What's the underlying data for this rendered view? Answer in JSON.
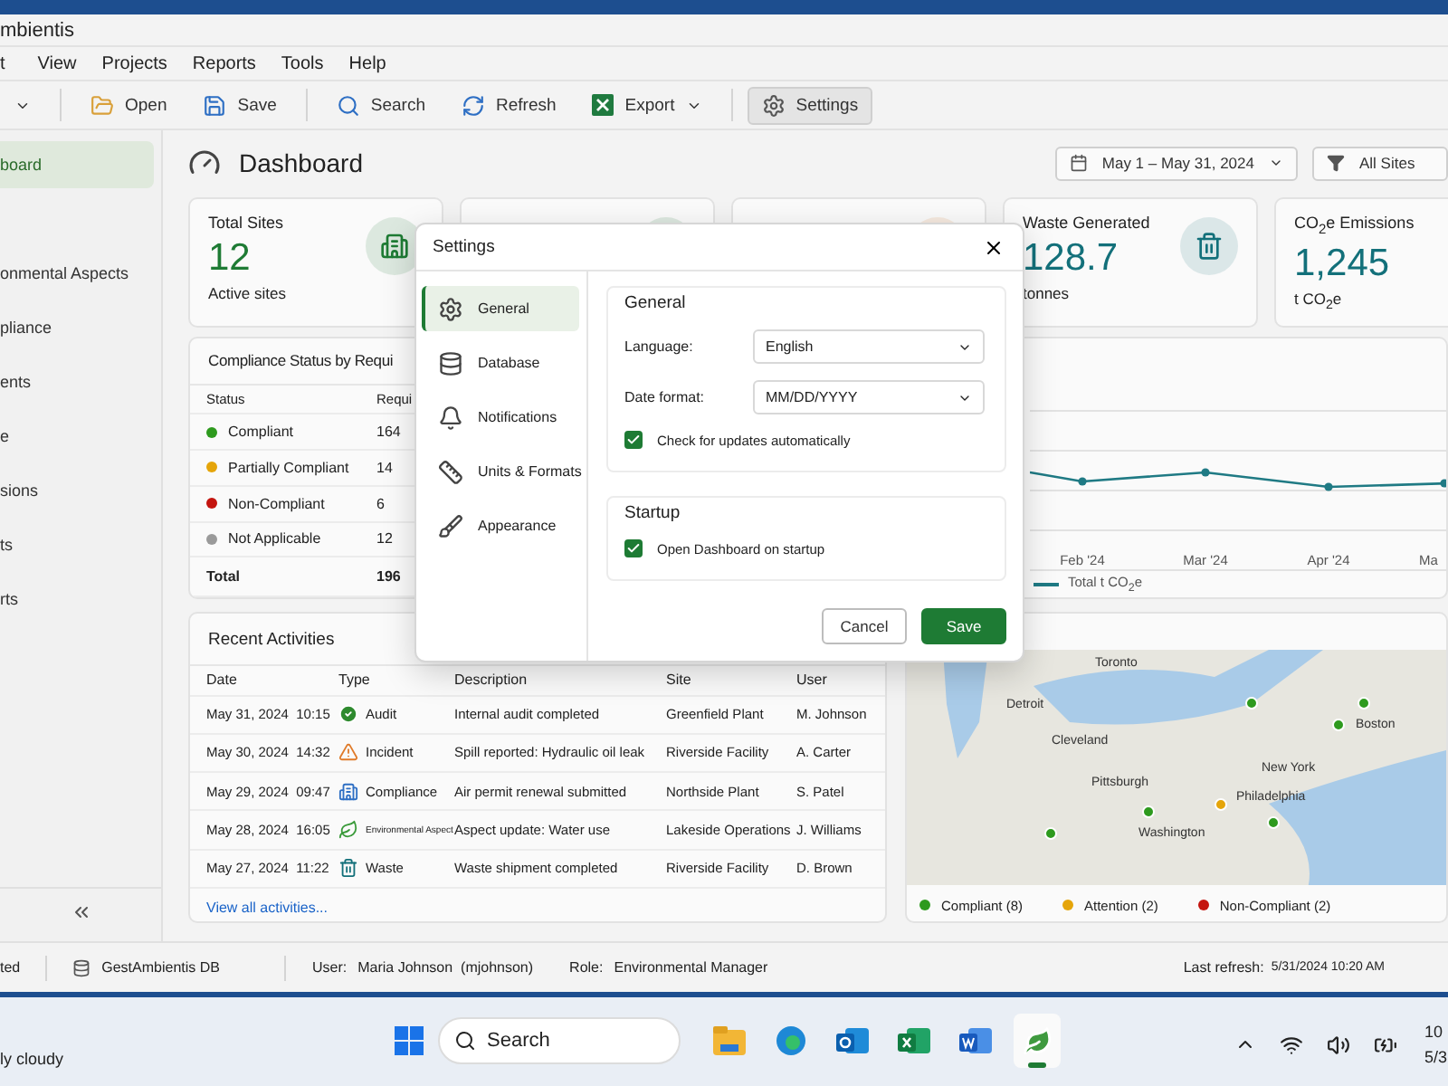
{
  "window": {
    "title": "mbientis"
  },
  "menu": [
    "t",
    "View",
    "Projects",
    "Reports",
    "Tools",
    "Help"
  ],
  "toolbar": [
    {
      "kind": "dropdown"
    },
    {
      "kind": "open",
      "label": "Open"
    },
    {
      "kind": "save",
      "label": "Save"
    },
    {
      "kind": "search",
      "label": "Search"
    },
    {
      "kind": "refresh",
      "label": "Refresh"
    },
    {
      "kind": "export",
      "label": "Export"
    },
    {
      "kind": "settings",
      "label": "Settings",
      "pressed": true
    }
  ],
  "sidebar": {
    "items": [
      {
        "label": "board",
        "selected": true
      },
      {
        "label": "onmental Aspects",
        "selected": false
      },
      {
        "label": "pliance",
        "selected": false
      },
      {
        "label": "ents",
        "selected": false
      },
      {
        "label": "e",
        "selected": false
      },
      {
        "label": "sions",
        "selected": false
      },
      {
        "label": "ts",
        "selected": false
      },
      {
        "label": "rts",
        "selected": false
      }
    ]
  },
  "header": {
    "title": "Dashboard",
    "date_range": "May 1 – May 31, 2024",
    "site_filter": "All Sites"
  },
  "cards": [
    {
      "kind": "sites",
      "title": "Total Sites",
      "value": "12",
      "caption": "Active sites"
    },
    {
      "kind": "compliance"
    },
    {
      "kind": "incidents"
    },
    {
      "kind": "waste",
      "title": "Waste Generated",
      "value": "128.7",
      "caption": "tonnes"
    },
    {
      "kind": "emissions",
      "title": "CO$_{2}$e Emissions",
      "value": "1,245",
      "caption": "t CO$_{2}$e"
    }
  ],
  "compliance": {
    "title": "Compliance Status by Requi",
    "columns": [
      "Status",
      "Requi"
    ],
    "rows": [
      {
        "status": "Compliant",
        "count": "164",
        "color": "#2e9a1e"
      },
      {
        "status": "Partially Compliant",
        "count": "14",
        "color": "#e5a50a"
      },
      {
        "status": "Non-Compliant",
        "count": "6",
        "color": "#c4150f"
      },
      {
        "status": "Not Applicable",
        "count": "12",
        "color": "#9a9a9a"
      }
    ],
    "total": {
      "label": "Total",
      "count": "196"
    }
  },
  "emissions_chart": {
    "x_labels": [
      "Feb '24",
      "Mar '24",
      "Apr '24",
      "Ma"
    ],
    "legend": "Total t CO$_{2}$e"
  },
  "activities": {
    "title": "Recent Activities",
    "columns": [
      "Date",
      "Type",
      "Description",
      "Site",
      "User"
    ],
    "rows": [
      {
        "date": "May 31, 2024",
        "time": "10:15",
        "kind": "audit",
        "type": "Audit",
        "description": "Internal audit completed",
        "site": "Greenfield Plant",
        "user": "M. Johnson"
      },
      {
        "date": "May 30, 2024",
        "time": "14:32",
        "kind": "incident",
        "type": "Incident",
        "description": "Spill reported: Hydraulic oil leak",
        "site": "Riverside Facility",
        "user": "A. Carter"
      },
      {
        "date": "May 29, 2024",
        "time": "09:47",
        "kind": "compliance",
        "type": "Compliance",
        "description": "Air permit renewal submitted",
        "site": "Northside Plant",
        "user": "S. Patel"
      },
      {
        "date": "May 28, 2024",
        "time": "16:05",
        "kind": "aspect",
        "type": "Environmental Aspect",
        "description": "Aspect update: Water use",
        "site": "Lakeside Operations",
        "user": "J. Williams"
      },
      {
        "date": "May 27, 2024",
        "time": "11:22",
        "kind": "waste",
        "type": "Waste",
        "description": "Waste shipment completed",
        "site": "Riverside Facility",
        "user": "D. Brown"
      }
    ],
    "link": "View all activities..."
  },
  "map": {
    "cities": [
      "Toronto",
      "Detroit",
      "Cleveland",
      "Pittsburgh",
      "New York",
      "Philadelphia",
      "Washington",
      "Boston"
    ],
    "pins": [
      {
        "color": "#2e9a1e"
      },
      {
        "color": "#2e9a1e"
      },
      {
        "color": "#2e9a1e"
      },
      {
        "color": "#2e9a1e"
      },
      {
        "color": "#2e9a1e"
      },
      {
        "color": "#2e9a1e"
      },
      {
        "color": "#e5a50a"
      }
    ],
    "legend": [
      {
        "label": "Compliant (8)",
        "color": "#2e9a1e"
      },
      {
        "label": "Attention (2)",
        "color": "#e5a50a"
      },
      {
        "label": "Non-Compliant (2)",
        "color": "#c4150f"
      }
    ]
  },
  "status_bar": {
    "connection": "ted",
    "database": "GestAmbientis DB",
    "user_label": "User:",
    "user": "Maria Johnson  (mjohnson)",
    "role_label": "Role:",
    "role": "Environmental Manager",
    "refresh_label": "Last refresh:",
    "refresh": "5/31/2024 10:20 AM"
  },
  "settings_dialog": {
    "title": "Settings",
    "nav": [
      {
        "kind": "general",
        "label": "General",
        "selected": true
      },
      {
        "kind": "database",
        "label": "Database",
        "selected": false
      },
      {
        "kind": "notifications",
        "label": "Notifications",
        "selected": false
      },
      {
        "kind": "units",
        "label": "Units & Formats",
        "selected": false
      },
      {
        "kind": "appearance",
        "label": "Appearance",
        "selected": false
      }
    ],
    "general": {
      "title": "General",
      "language_label": "Language:",
      "language": "English",
      "date_format_label": "Date format:",
      "date_format": "MM/DD/YYYY",
      "check_updates": {
        "label": "Check for updates automatically",
        "checked": true
      }
    },
    "startup": {
      "title": "Startup",
      "open_dashboard": {
        "label": "Open Dashboard on startup",
        "checked": true
      }
    },
    "buttons": {
      "cancel": "Cancel",
      "save": "Save"
    }
  },
  "taskbar": {
    "weather": "ly cloudy",
    "search": "Search",
    "apps": [
      {
        "kind": "files",
        "active": false
      },
      {
        "kind": "edge",
        "active": false
      },
      {
        "kind": "outlook",
        "active": false
      },
      {
        "kind": "excel",
        "active": false
      },
      {
        "kind": "word",
        "active": false
      },
      {
        "kind": "gest",
        "active": true
      }
    ],
    "time": "10",
    "date": "5/3"
  }
}
